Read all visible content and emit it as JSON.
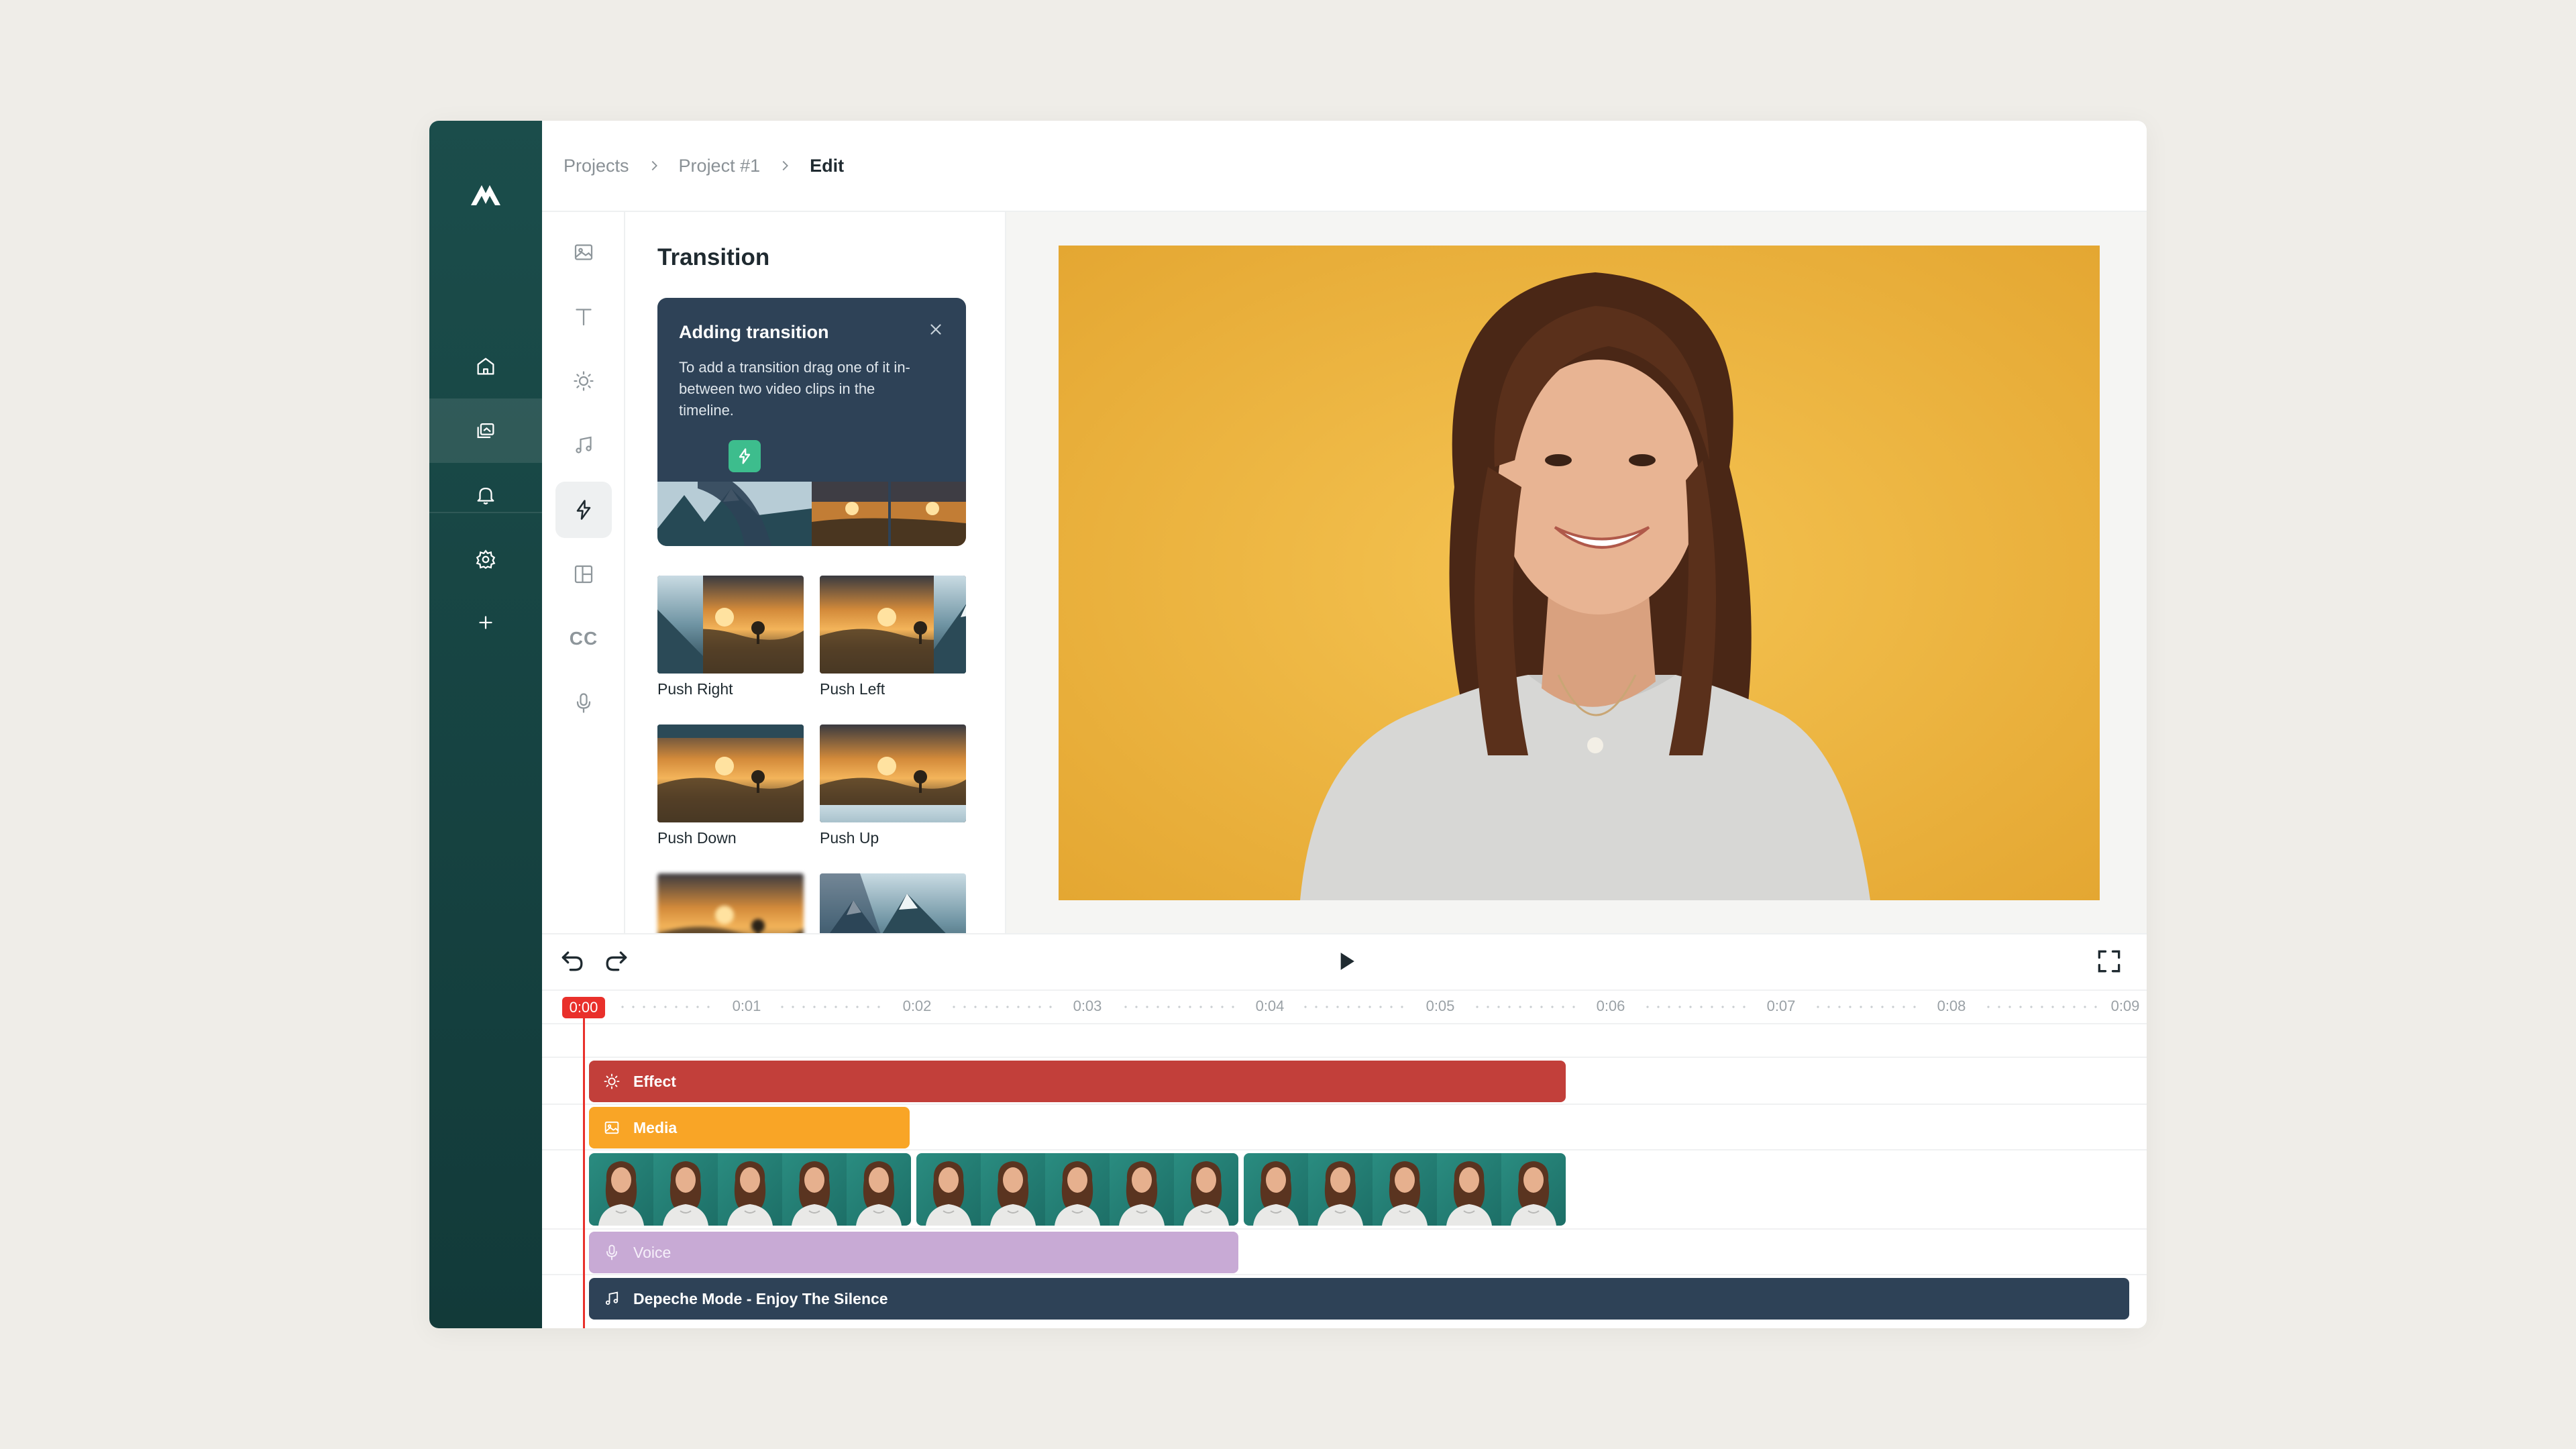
{
  "breadcrumb": {
    "items": [
      "Projects",
      "Project #1"
    ],
    "current": "Edit"
  },
  "rail": {
    "items": [
      "home-icon",
      "projects-icon",
      "bell-icon",
      "gear-icon",
      "plus-icon"
    ],
    "active": "projects-icon"
  },
  "tools": {
    "items": [
      "image-icon",
      "text-icon",
      "brightness-icon",
      "music-icon",
      "bolt-icon",
      "layout-icon",
      "captions-icon",
      "microphone-icon"
    ],
    "captions_label": "CC",
    "active": "bolt-icon"
  },
  "panel": {
    "title": "Transition",
    "tip": {
      "title": "Adding transition",
      "text": "To add a transition drag one of it in-between two video clips in the timeline."
    },
    "transitions": [
      {
        "label": "Push Right"
      },
      {
        "label": "Push Left"
      },
      {
        "label": "Push Down"
      },
      {
        "label": "Push Up"
      },
      {
        "label": ""
      },
      {
        "label": ""
      }
    ]
  },
  "timeline": {
    "playhead": "0:00",
    "ticks": [
      "0:01",
      "0:02",
      "0:03",
      "0:04",
      "0:05",
      "0:06",
      "0:07",
      "0:08",
      "0:09"
    ],
    "tracks": {
      "effect": "Effect",
      "media": "Media",
      "voice": "Voice",
      "music": "Depeche Mode - Enjoy The Silence"
    }
  },
  "colors": {
    "rail": "#1b4d4b",
    "effect": "#c23f3a",
    "media": "#f9a526",
    "voice": "#c8aad5",
    "music": "#2e4257",
    "playhead": "#e9302b",
    "accent": "#3dbd8d"
  }
}
